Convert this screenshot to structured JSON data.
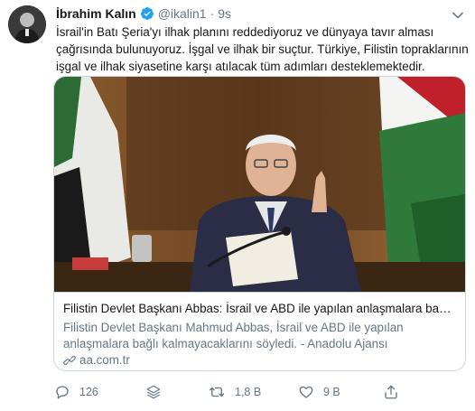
{
  "tweet": {
    "author_name": "İbrahim Kalın",
    "handle": "@ikalin1",
    "separator": "·",
    "time": "9s",
    "text_lines": [
      "İsrail'in Batı Şeria'yı ilhak planını reddediyoruz ve dünyaya tavır alması",
      "çağrısında bulunuyoruz. İşgal ve ilhak bir suçtur. Türkiye, Filistin topraklarının",
      "işgal ve ilhak siyasetine karşı atılacak tüm adımları desteklemektedir."
    ]
  },
  "card": {
    "title": "Filistin Devlet Başkanı Abbas: İsrail ve ABD ile yapılan anlaşmalara bağlı ...",
    "description_lines": [
      "Filistin Devlet Başkanı Mahmud Abbas, İsrail ve ABD ile yapılan",
      "anlaşmalara bağlı kalmayacaklarını söyledi. - Anadolu Ajansı"
    ],
    "domain": "aa.com.tr"
  },
  "actions": {
    "reply_count": "126",
    "retweet_count": "1,8 B",
    "like_count": "9 B"
  },
  "colors": {
    "verified": "#1da1f2",
    "secondary_text": "#657786",
    "border": "#ccd6dd"
  },
  "icons": [
    "verified-badge-icon",
    "chevron-down-icon",
    "reply-icon",
    "stack-icon",
    "retweet-icon",
    "like-icon",
    "share-icon",
    "link-icon"
  ]
}
